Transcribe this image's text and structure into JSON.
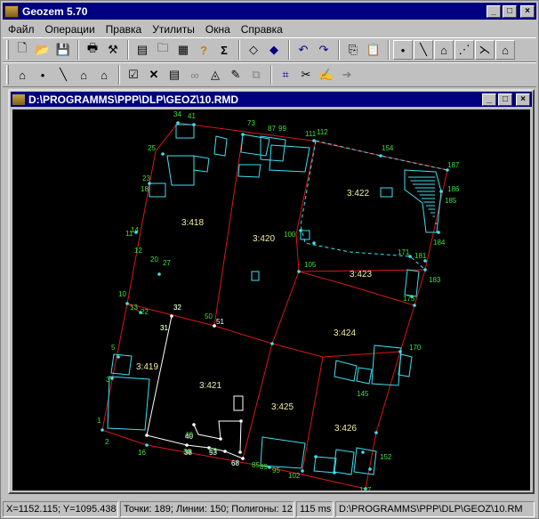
{
  "app": {
    "title": "Geozem 5.70",
    "minimize": "_",
    "maximize": "□",
    "close": "×"
  },
  "menu": [
    "Файл",
    "Операции",
    "Правка",
    "Утилиты",
    "Окна",
    "Справка"
  ],
  "toolbar1": [
    "new-file-icon",
    "open-file-icon",
    "save-file-icon",
    "print-icon",
    "tools-icon",
    "copy-doc-icon",
    "open-folder-icon",
    "calculator-icon",
    "help-icon",
    "sum-icon",
    "eraser-icon",
    "erase-all-icon",
    "undo-icon",
    "redo-icon",
    "copy-icon",
    "paste-icon",
    "point-icon",
    "line-icon",
    "polygon-icon",
    "node-icon",
    "split-icon",
    "house-icon"
  ],
  "toolbar2": [
    "camera-icon",
    "point-icon",
    "line-icon",
    "polygon-icon",
    "house-icon",
    "checkbox-icon",
    "delete-icon",
    "text-icon",
    "link-icon",
    "triangle-icon",
    "edit-icon",
    "layers-icon",
    "select-nodes-icon",
    "cut-icon",
    "sign-icon",
    "move-icon"
  ],
  "document": {
    "title": "D:\\PROGRAMMS\\PPP\\DLP\\GEOZ\\10.RMD"
  },
  "map": {
    "parcels": [
      "3:418",
      "3:420",
      "3:422",
      "3:423",
      "3:424",
      "3:419",
      "3:421",
      "3:425",
      "3:426"
    ],
    "point_labels_green": [
      "34",
      "41",
      "73",
      "87",
      "99",
      "111",
      "112",
      "154",
      "187",
      "186",
      "185",
      "184",
      "181",
      "171",
      "183",
      "175",
      "170",
      "152",
      "147",
      "145",
      "102",
      "95",
      "89",
      "85",
      "68",
      "53",
      "38",
      "40",
      "16",
      "2",
      "1",
      "3",
      "5",
      "22",
      "13",
      "10",
      "12",
      "14",
      "11",
      "20",
      "27",
      "23",
      "18",
      "25",
      "100",
      "105",
      "50",
      "32",
      "31"
    ],
    "point_labels_white": [
      "51",
      "32",
      "31",
      "40",
      "38",
      "53",
      "68"
    ],
    "colors": {
      "boundary": "#d81818",
      "building": "#40e0f0",
      "label_point": "#40e040",
      "label_parcel": "#f0f0a0",
      "white_line": "#ffffff"
    }
  },
  "status": {
    "coords": "X=1152.115; Y=1095.438",
    "counts": "Точки: 189; Линии: 150; Полигоны: 12",
    "time": "115 ms",
    "path": "D:\\PROGRAMMS\\PPP\\DLP\\GEOZ\\10.RM"
  }
}
